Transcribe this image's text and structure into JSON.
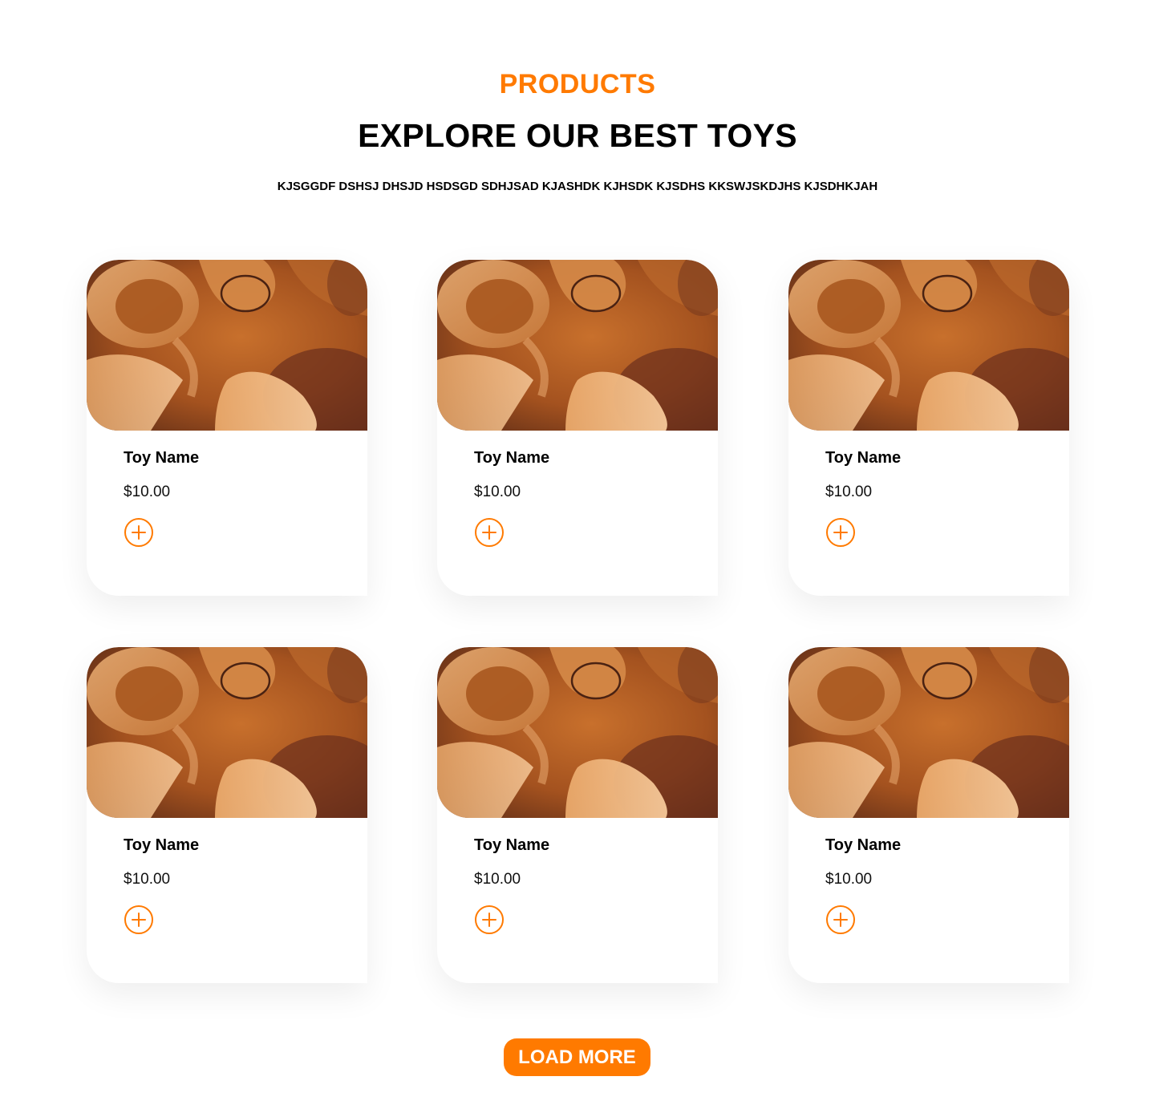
{
  "header": {
    "eyebrow": "PRODUCTS",
    "title": "EXPLORE OUR BEST TOYS",
    "subtitle": "KJSGGDF DSHSJ DHSJD HSDSGD SDHJSAD KJASHDK KJHSDK KJSDHS KKSWJSKDJHS KJSDHKJAH"
  },
  "products": [
    {
      "name": "Toy Name",
      "price": "$10.00",
      "image_icon": "wood-shavings-photo",
      "action_icon": "plus-circle-icon"
    },
    {
      "name": "Toy Name",
      "price": "$10.00",
      "image_icon": "wood-shavings-photo",
      "action_icon": "plus-circle-icon"
    },
    {
      "name": "Toy Name",
      "price": "$10.00",
      "image_icon": "wood-shavings-photo",
      "action_icon": "plus-circle-icon"
    },
    {
      "name": "Toy Name",
      "price": "$10.00",
      "image_icon": "wood-shavings-photo",
      "action_icon": "plus-circle-icon"
    },
    {
      "name": "Toy Name",
      "price": "$10.00",
      "image_icon": "wood-shavings-photo",
      "action_icon": "plus-circle-icon"
    },
    {
      "name": "Toy Name",
      "price": "$10.00",
      "image_icon": "wood-shavings-photo",
      "action_icon": "plus-circle-icon"
    }
  ],
  "load_more_label": "LOAD MORE",
  "colors": {
    "accent": "#ff7a00",
    "text": "#000000",
    "background": "#ffffff"
  }
}
